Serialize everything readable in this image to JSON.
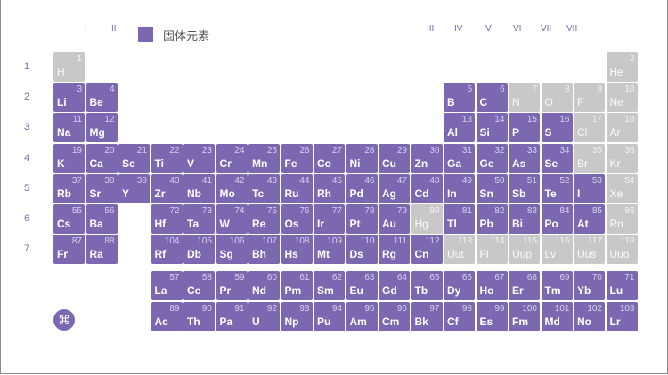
{
  "groups": [
    "I",
    "II",
    "III",
    "IV",
    "V",
    "VI",
    "VII",
    "VII"
  ],
  "periods": [
    "1",
    "2",
    "3",
    "4",
    "5",
    "6",
    "7"
  ],
  "legend": {
    "label": "固体元素",
    "color": "#7b68b0"
  },
  "colors": {
    "solid": "#7b68b0",
    "other": "#c8c8c8"
  },
  "menu_icon": "clover-menu-icon",
  "symbols": [
    "H",
    "He",
    "Li",
    "Be",
    "B",
    "C",
    "N",
    "O",
    "F",
    "Ne",
    "Na",
    "Mg",
    "Al",
    "Si",
    "P",
    "S",
    "Cl",
    "Ar",
    "K",
    "Ca",
    "Sc",
    "Ti",
    "V",
    "Cr",
    "Mn",
    "Fe",
    "Co",
    "Ni",
    "Cu",
    "Zn",
    "Ga",
    "Ge",
    "As",
    "Se",
    "Br",
    "Kr",
    "Rb",
    "Sr",
    "Y",
    "Zr",
    "Nb",
    "Mo",
    "Tc",
    "Ru",
    "Rh",
    "Pd",
    "Ag",
    "Cd",
    "In",
    "Sn",
    "Sb",
    "Te",
    "I",
    "Xe",
    "Cs",
    "Ba",
    "La",
    "Ce",
    "Pr",
    "Nd",
    "Pm",
    "Sm",
    "Eu",
    "Gd",
    "Tb",
    "Dy",
    "Ho",
    "Er",
    "Tm",
    "Yb",
    "Lu",
    "Hf",
    "Ta",
    "W",
    "Re",
    "Os",
    "Ir",
    "Pt",
    "Au",
    "Hg",
    "Tl",
    "Pb",
    "Bi",
    "Po",
    "At",
    "Rn",
    "Fr",
    "Ra",
    "Ac",
    "Th",
    "Pa",
    "U",
    "Np",
    "Pu",
    "Am",
    "Cm",
    "Bk",
    "Cf",
    "Es",
    "Fm",
    "Md",
    "No",
    "Lr",
    "Rf",
    "Db",
    "Sg",
    "Bh",
    "Hs",
    "Mt",
    "Ds",
    "Rg",
    "Cn",
    "Uut",
    "Fl",
    "Uup",
    "Lv",
    "Uus",
    "Uuo"
  ],
  "non_solid_numbers": [
    1,
    2,
    7,
    8,
    9,
    10,
    17,
    18,
    35,
    36,
    54,
    80,
    86,
    113,
    114,
    115,
    116,
    117,
    118
  ]
}
